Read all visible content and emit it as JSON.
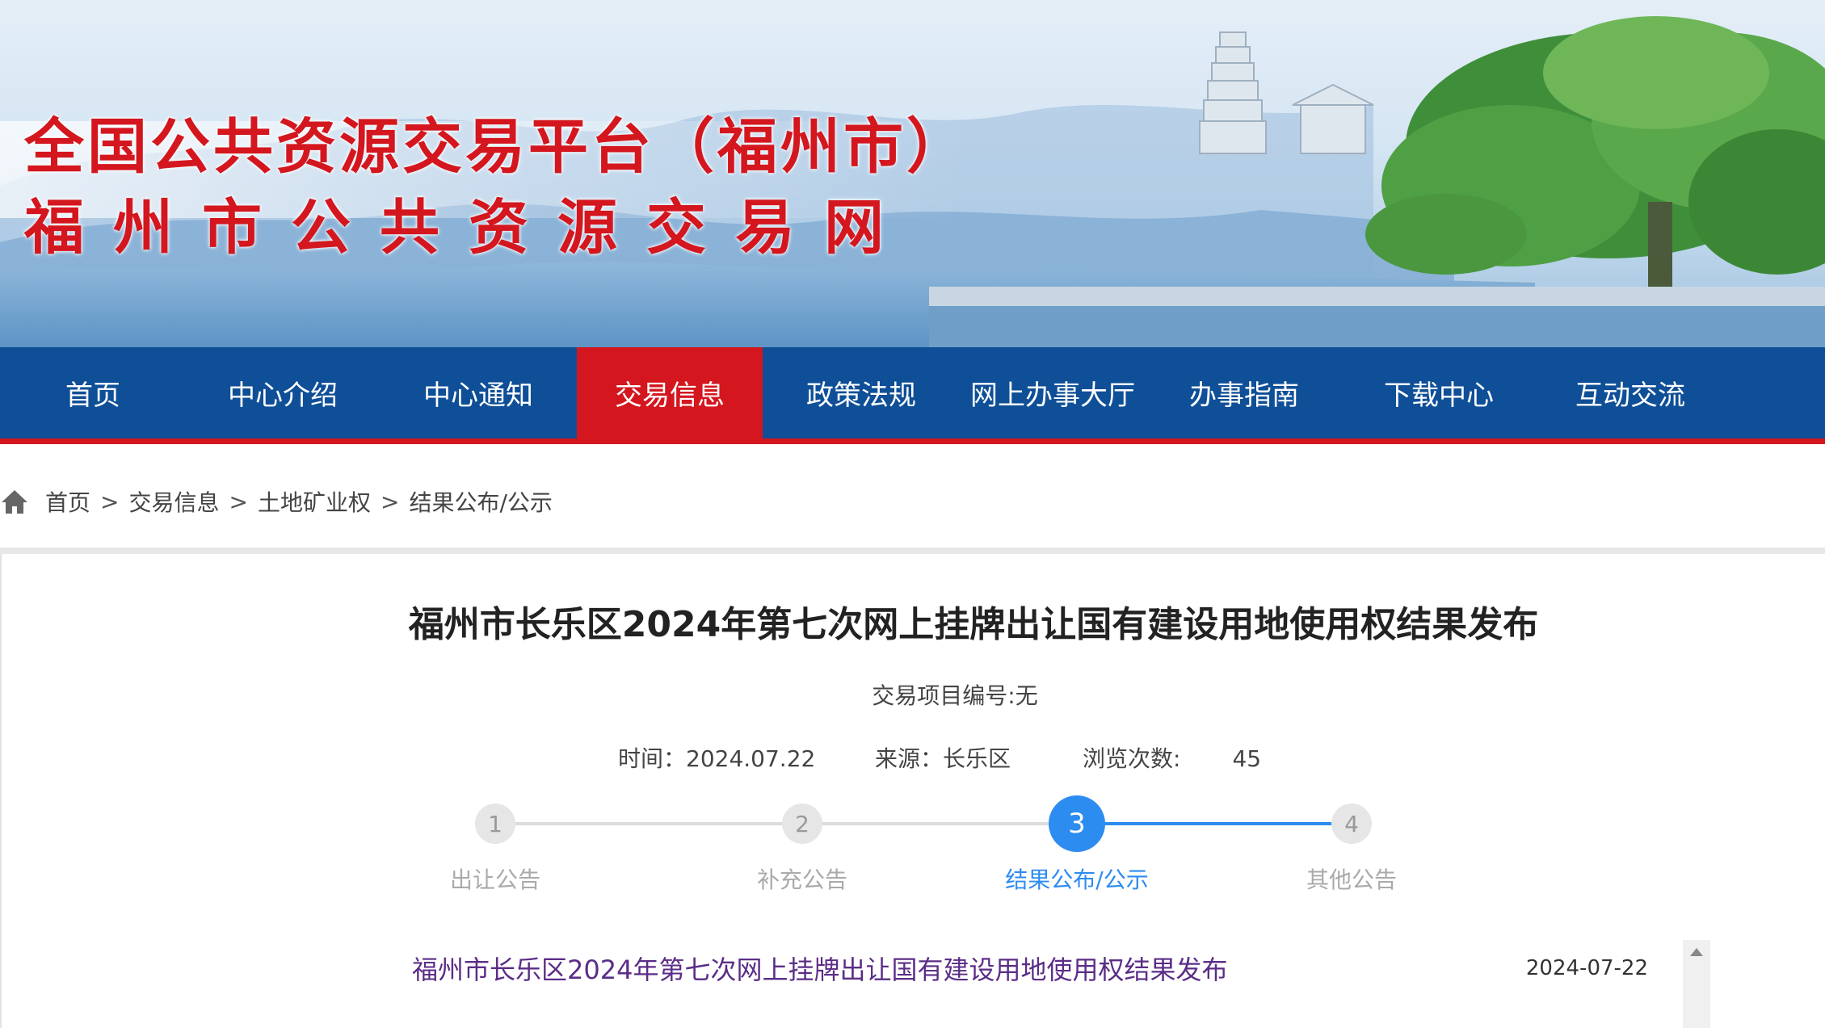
{
  "banner": {
    "title_line1": "全国公共资源交易平台（福州市）",
    "title_line2": "福州市公共资源交易网"
  },
  "nav": {
    "items": [
      {
        "label": "首页"
      },
      {
        "label": "中心介绍"
      },
      {
        "label": "中心通知"
      },
      {
        "label": "交易信息"
      },
      {
        "label": "政策法规"
      },
      {
        "label": "网上办事大厅"
      },
      {
        "label": "办事指南"
      },
      {
        "label": "下载中心"
      },
      {
        "label": "互动交流"
      }
    ],
    "active_label": "交易信息",
    "colors": {
      "bar": "#0f4f97",
      "active": "#d4161e"
    }
  },
  "breadcrumb": {
    "icon": "home-icon",
    "items": [
      "首页",
      "交易信息",
      "土地矿业权",
      "结果公布/公示"
    ],
    "separator": ">"
  },
  "article": {
    "title": "福州市长乐区2024年第七次网上挂牌出让国有建设用地使用权结果发布",
    "project_no": "交易项目编号:无",
    "time_label": "时间：",
    "time_value": "2024.07.22",
    "source_label": "来源：",
    "source_value": "长乐区",
    "views_label": "浏览次数:",
    "views_value": "45"
  },
  "steps": {
    "items": [
      {
        "num": "1",
        "label": "出让公告"
      },
      {
        "num": "2",
        "label": "补充公告"
      },
      {
        "num": "3",
        "label": "结果公布/公示"
      },
      {
        "num": "4",
        "label": "其他公告"
      }
    ],
    "active_index": 3,
    "active_color": "#2d8cf0"
  },
  "list": {
    "rows": [
      {
        "title": "福州市长乐区2024年第七次网上挂牌出让国有建设用地使用权结果发布",
        "date": "2024-07-22"
      }
    ]
  }
}
